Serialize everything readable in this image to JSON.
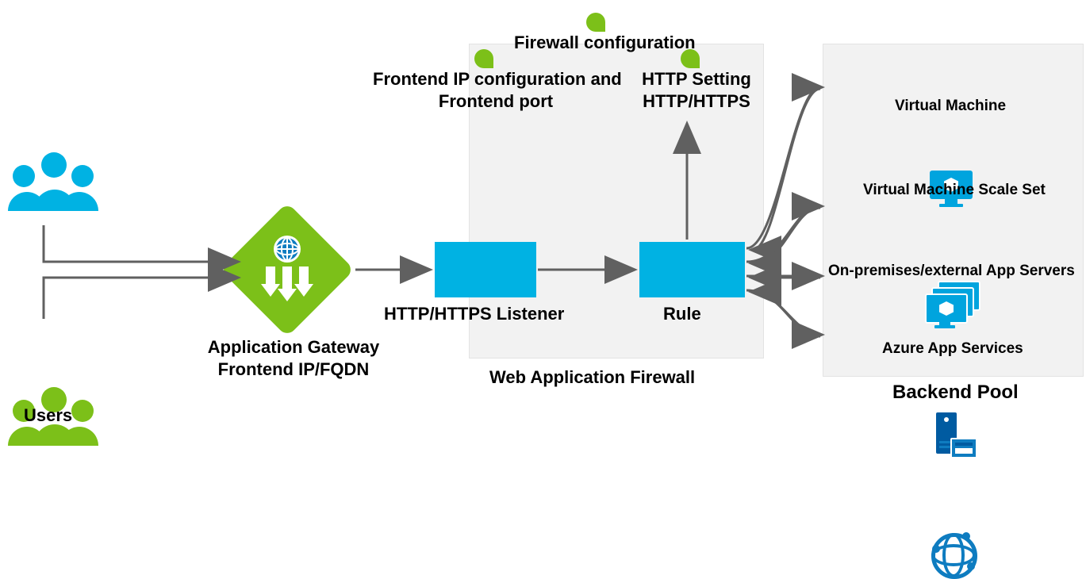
{
  "users_label": "Users",
  "app_gateway_label": "Application Gateway\nFrontend IP/FQDN",
  "firewall_config_label": "Firewall configuration",
  "frontend_label": "Frontend IP configuration and\nFrontend port",
  "http_setting_label": "HTTP Setting\nHTTP/HTTPS",
  "listener_label": "HTTP/HTTPS Listener",
  "rule_label": "Rule",
  "waf_label": "Web Application Firewall",
  "backend_pool_label": "Backend Pool",
  "backend": {
    "vm": "Virtual Machine",
    "vmss": "Virtual Machine Scale Set",
    "onprem": "On-premises/external App Servers",
    "appsvc": "Azure App Services"
  },
  "colors": {
    "azure_blue": "#00b2e3",
    "azure_green": "#7cc019",
    "dark_blue": "#005ba1",
    "arrow": "#606060"
  }
}
